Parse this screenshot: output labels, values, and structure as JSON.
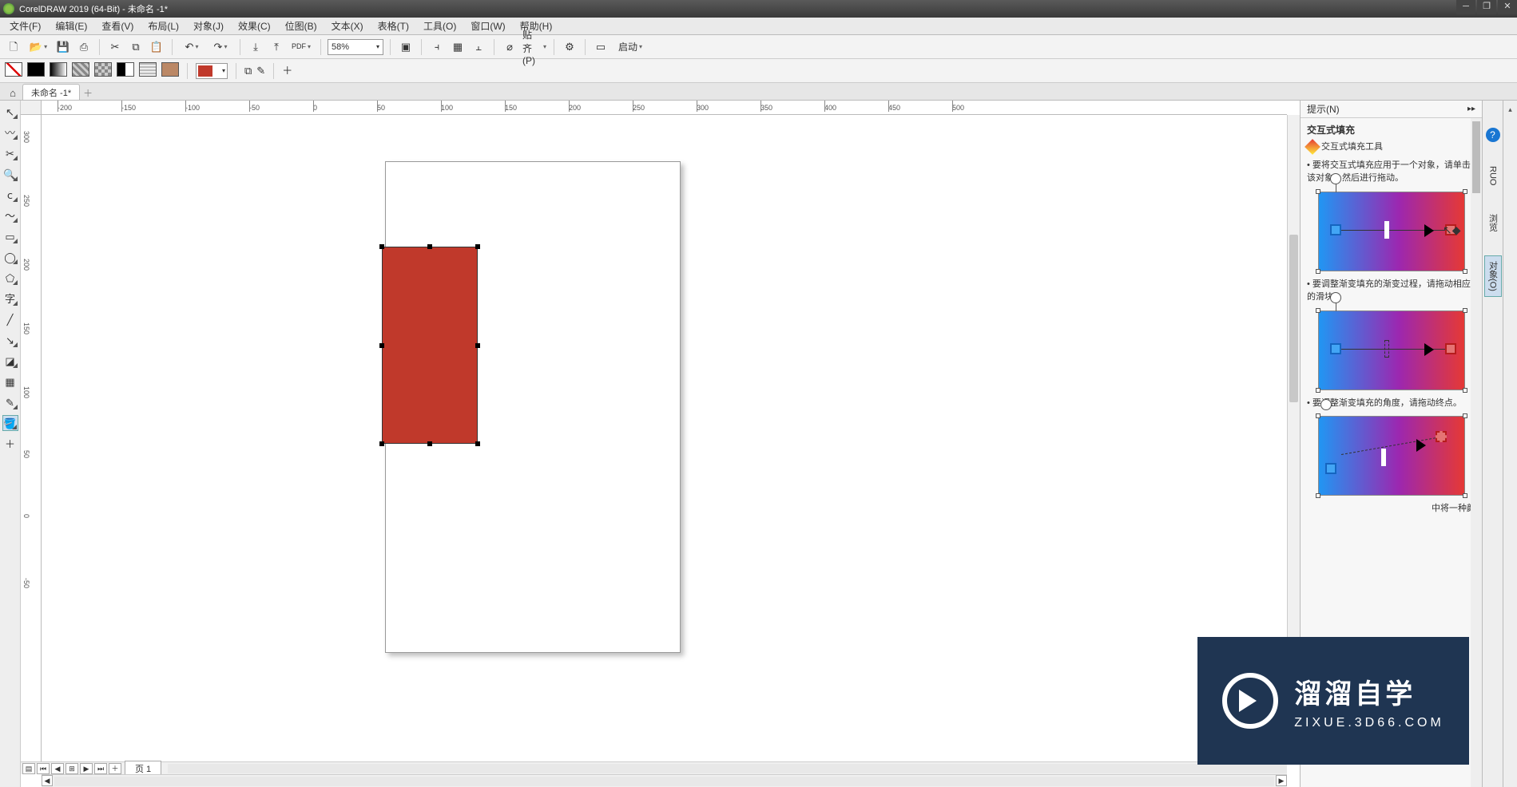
{
  "app": {
    "title": "CorelDRAW 2019 (64-Bit) - 未命名 -1*",
    "doc_tab": "未命名 -1*"
  },
  "menu": {
    "file": "文件(F)",
    "edit": "编辑(E)",
    "view": "查看(V)",
    "layout": "布局(L)",
    "object": "对象(J)",
    "effects": "效果(C)",
    "bitmap": "位图(B)",
    "text": "文本(X)",
    "table": "表格(T)",
    "tools": "工具(O)",
    "window": "窗口(W)",
    "help": "帮助(H)"
  },
  "toolbar": {
    "zoom": "58%",
    "snap_label": "贴齐(P)",
    "launch_label": "启动"
  },
  "fill": {
    "current_color": "#c0392b"
  },
  "ruler_h": [
    {
      "pos": 20,
      "label": "-200"
    },
    {
      "pos": 100,
      "label": "-150"
    },
    {
      "pos": 180,
      "label": "-100"
    },
    {
      "pos": 260,
      "label": "-50"
    },
    {
      "pos": 340,
      "label": "0"
    },
    {
      "pos": 420,
      "label": "50"
    },
    {
      "pos": 500,
      "label": "100"
    },
    {
      "pos": 580,
      "label": "150"
    },
    {
      "pos": 660,
      "label": "200"
    },
    {
      "pos": 740,
      "label": "250"
    },
    {
      "pos": 820,
      "label": "300"
    },
    {
      "pos": 900,
      "label": "350"
    },
    {
      "pos": 980,
      "label": "400"
    },
    {
      "pos": 1060,
      "label": "450"
    },
    {
      "pos": 1140,
      "label": "500"
    }
  ],
  "ruler_v": [
    {
      "pos": 20,
      "label": "300"
    },
    {
      "pos": 100,
      "label": "250"
    },
    {
      "pos": 180,
      "label": "200"
    },
    {
      "pos": 260,
      "label": "150"
    },
    {
      "pos": 340,
      "label": "100"
    },
    {
      "pos": 420,
      "label": "50"
    },
    {
      "pos": 500,
      "label": "0"
    },
    {
      "pos": 580,
      "label": "-50"
    }
  ],
  "page_nav": {
    "current_tab": "页 1"
  },
  "hints": {
    "docker_title": "提示(N)",
    "heading": "交互式填充",
    "tool_name": "交互式填充工具",
    "tip1": "要将交互式填充应用于一个对象，请单击该对象，然后进行拖动。",
    "tip2": "要调整渐变填充的渐变过程，请拖动相应的滑块。",
    "tip3": "要调整渐变填充的角度，请拖动终点。",
    "tip4_partial": "中将一种颜"
  },
  "right_tabs": {
    "ruo": "RUO",
    "t1": "浏览",
    "t2": "对象(O)"
  },
  "watermark": {
    "line1": "溜溜自学",
    "line2": "ZIXUE.3D66.COM"
  }
}
